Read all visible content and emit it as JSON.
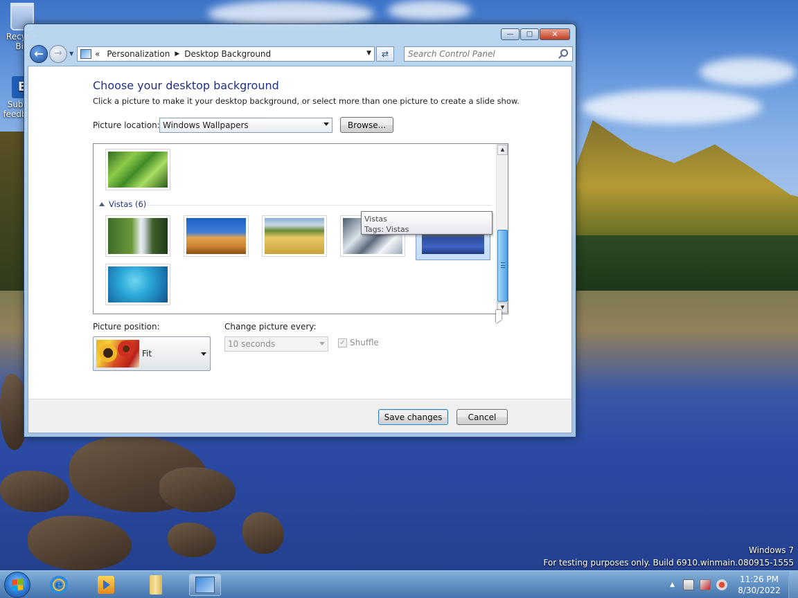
{
  "desktop": {
    "icons": [
      {
        "label": "Recycle Bin"
      },
      {
        "label": "Submit feedback"
      }
    ],
    "watermark": {
      "line1": "Windows 7",
      "line2": "For testing purposes only. Build 6910.winmain.080915-1555"
    }
  },
  "window": {
    "address": {
      "chevrons": "«",
      "crumbs": [
        "Personalization",
        "Desktop Background"
      ]
    },
    "search": {
      "placeholder": "Search Control Panel"
    },
    "heading": "Choose your desktop background",
    "subtext": "Click a picture to make it your desktop background, or select more than one picture to create a slide show.",
    "location": {
      "label": "Picture location:",
      "value": "Windows Wallpapers",
      "browse": "Browse..."
    },
    "gallery": {
      "group": "Vistas (6)",
      "tooltip": {
        "line1": "Vistas",
        "line2": "Tags: Vistas"
      }
    },
    "position": {
      "label": "Picture position:",
      "value": "Fit"
    },
    "interval": {
      "label": "Change picture every:",
      "value": "10 seconds"
    },
    "shuffle": {
      "label": "Shuffle",
      "checked": true
    },
    "buttons": {
      "save": "Save changes",
      "cancel": "Cancel"
    }
  },
  "taskbar": {
    "clock": {
      "time": "11:26 PM",
      "date": "8/30/2022"
    }
  }
}
